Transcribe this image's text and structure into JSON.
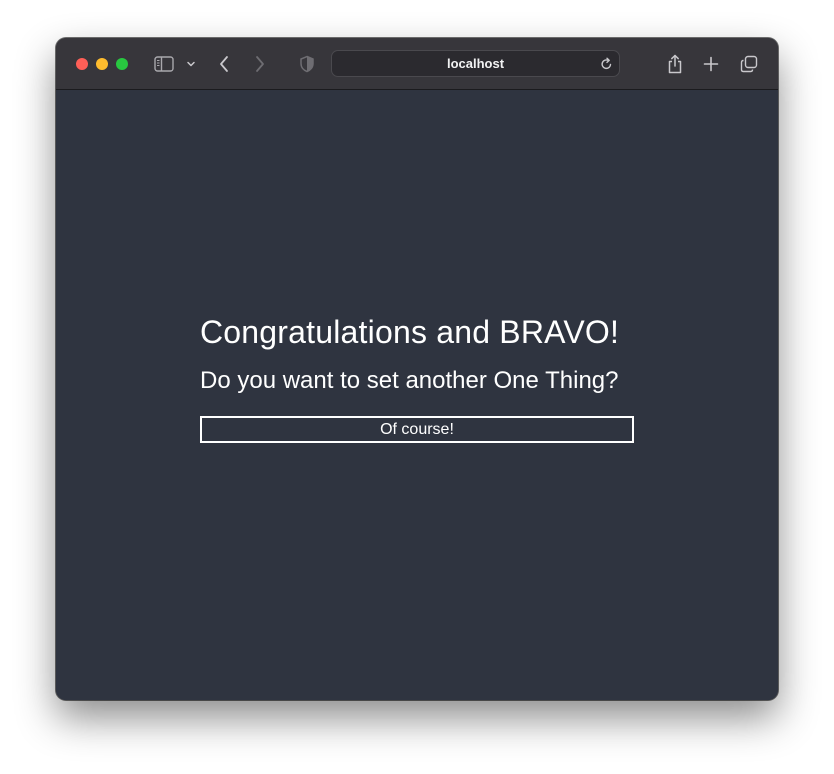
{
  "browser": {
    "address": "localhost",
    "icons": {
      "sidebar": "sidebar-icon",
      "sidebar_menu": "chevron-down-icon",
      "back": "chevron-left-icon",
      "forward": "chevron-right-icon",
      "privacy": "shield-icon",
      "reload": "reload-icon",
      "share": "share-icon",
      "new_tab": "plus-icon",
      "tab_overview": "tabs-icon"
    },
    "traffic_lights": [
      "#fe5f57",
      "#febc2e",
      "#28c840"
    ]
  },
  "page": {
    "background": "#2f3440",
    "heading": "Congratulations and BRAVO!",
    "subheading": "Do you want to set another One Thing?",
    "button_label": "Of course!"
  }
}
